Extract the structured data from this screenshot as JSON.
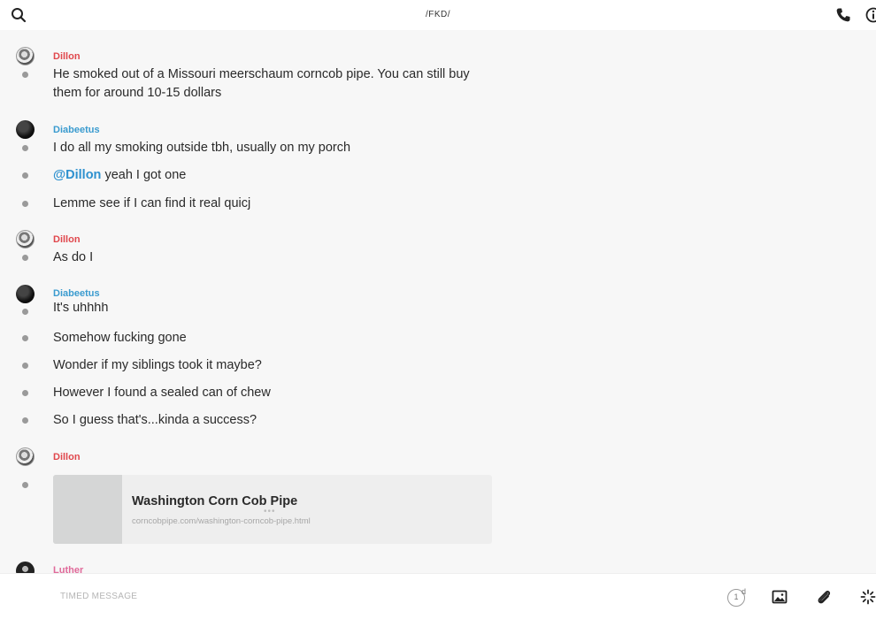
{
  "header": {
    "title": "/FKD/",
    "search_icon": "search-icon",
    "call_icon": "phone-icon",
    "info_icon": "info-icon"
  },
  "messages": [
    {
      "sender": "Dillon",
      "lines": [
        "He smoked out of a Missouri meerschaum corncob pipe. You can still buy",
        "them for around 10-15 dollars"
      ]
    },
    {
      "sender": "Diabeetus",
      "lines": [
        "I do all my smoking outside tbh, usually on my porch"
      ]
    },
    {
      "sender": "Diabeetus",
      "mention": "@Dillon",
      "text": " yeah I got one"
    },
    {
      "sender": "Diabeetus",
      "lines": [
        "Lemme see if I can find it real quicj"
      ]
    },
    {
      "sender": "Dillon",
      "lines": [
        "As do I"
      ]
    },
    {
      "sender": "Diabeetus",
      "lines": [
        "It's uhhhh"
      ]
    },
    {
      "sender": "Diabeetus",
      "lines": [
        "Somehow fucking gone"
      ]
    },
    {
      "sender": "Diabeetus",
      "lines": [
        "Wonder if my siblings took it maybe?"
      ]
    },
    {
      "sender": "Diabeetus",
      "lines": [
        "However I found a sealed can of chew"
      ]
    },
    {
      "sender": "Diabeetus",
      "lines": [
        "So I guess that's...kinda a success?"
      ]
    },
    {
      "sender": "Dillon",
      "link_preview": {
        "title": "Washington Corn Cob Pipe",
        "url": "corncobpipe.com/washington-corncob-pipe.html"
      }
    },
    {
      "sender": "Luther"
    }
  ],
  "composer": {
    "placeholder": "TIMED MESSAGE",
    "timer_value": "1",
    "timer_unit": "d"
  },
  "colors": {
    "dillon": "#e0474c",
    "diabeetus": "#3a9bcf",
    "luther": "#e06a9a",
    "mention": "#2e91cf"
  }
}
